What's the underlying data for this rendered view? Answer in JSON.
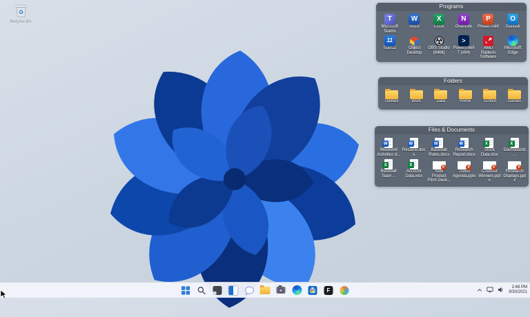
{
  "desktop": {
    "recycle_bin_label": "Recycle Bin"
  },
  "fences": [
    {
      "title": "Programs",
      "items": [
        {
          "label": "Microsoft Teams",
          "icon": "teams",
          "glyph": "T"
        },
        {
          "label": "Word",
          "icon": "word",
          "glyph": "W"
        },
        {
          "label": "Excel",
          "icon": "excel",
          "glyph": "X"
        },
        {
          "label": "OneNote",
          "icon": "onenote",
          "glyph": "N"
        },
        {
          "label": "PowerPoint",
          "icon": "powerpoint",
          "glyph": "P"
        },
        {
          "label": "Outlook",
          "icon": "outlook",
          "glyph": "O"
        },
        {
          "label": "Start11",
          "icon": "start11",
          "glyph": "11"
        },
        {
          "label": "Object Desktop",
          "icon": "cube"
        },
        {
          "label": "OBS Studio (64bit)",
          "icon": "obs"
        },
        {
          "label": "PowerShell 7 (x64)",
          "icon": "powershell",
          "glyph": ">"
        },
        {
          "label": "AMD Radeon Software",
          "icon": "amd"
        },
        {
          "label": "Microsoft Edge",
          "icon": "edge"
        }
      ]
    },
    {
      "title": "Folders",
      "items": [
        {
          "label": "Utilities",
          "icon": "folder"
        },
        {
          "label": "Work",
          "icon": "folder"
        },
        {
          "label": "Data",
          "icon": "folder"
        },
        {
          "label": "Home",
          "icon": "folder"
        },
        {
          "label": "School",
          "icon": "folder"
        },
        {
          "label": "Games",
          "icon": "folder"
        }
      ]
    },
    {
      "title": "Files & Documents",
      "items": [
        {
          "label": "Weekend Activities d...",
          "icon": "worddoc",
          "glyph": "W"
        },
        {
          "label": "Resume.docx",
          "icon": "worddoc",
          "glyph": "W"
        },
        {
          "label": "Baseball Rules.docx",
          "icon": "worddoc",
          "glyph": "W"
        },
        {
          "label": "Research Report.docx",
          "icon": "worddoc",
          "glyph": "W"
        },
        {
          "label": "Stock Data.xlsx",
          "icon": "exceldoc",
          "glyph": "X"
        },
        {
          "label": "Dashboards...",
          "icon": "exceldoc",
          "glyph": "X"
        },
        {
          "label": "Baseball Team ...",
          "icon": "exceldoc",
          "glyph": "X"
        },
        {
          "label": "Account Data.xlsx",
          "icon": "exceldoc",
          "glyph": "X"
        },
        {
          "label": "New Product Pitch Deck...",
          "icon": "pptslide",
          "glyph": "P"
        },
        {
          "label": "Travel Agenda.pptx",
          "icon": "pptslide",
          "glyph": "P"
        },
        {
          "label": "Cookout Winners.pptx",
          "icon": "pptslide",
          "glyph": "P"
        },
        {
          "label": "Research Displays.pptx",
          "icon": "pptslide",
          "glyph": "P"
        }
      ]
    }
  ],
  "taskbar": {
    "buttons": [
      {
        "name": "start"
      },
      {
        "name": "search"
      },
      {
        "name": "task-view"
      },
      {
        "name": "widgets"
      },
      {
        "name": "chat"
      },
      {
        "name": "file-explorer"
      },
      {
        "name": "camera"
      },
      {
        "name": "edge"
      },
      {
        "name": "microsoft-store"
      },
      {
        "name": "fences",
        "glyph": "F"
      },
      {
        "name": "stardock-app"
      }
    ],
    "tray": {
      "icons": [
        {
          "name": "hidden-icons-chevron"
        },
        {
          "name": "display"
        },
        {
          "name": "speaker"
        }
      ],
      "time": "2:48 PM",
      "date": "9/30/2021"
    }
  },
  "colors": {
    "accent": "#1a66d0",
    "fence_background": "rgba(71,81,94,0.82)",
    "taskbar_background": "#f1f4fa",
    "wallpaper_base": "#ccd6e1",
    "bloom_blues": [
      "#2a6fe2",
      "#0d3d9a",
      "#3b82ee",
      "#0a2f7d",
      "#1f5fd0"
    ]
  }
}
